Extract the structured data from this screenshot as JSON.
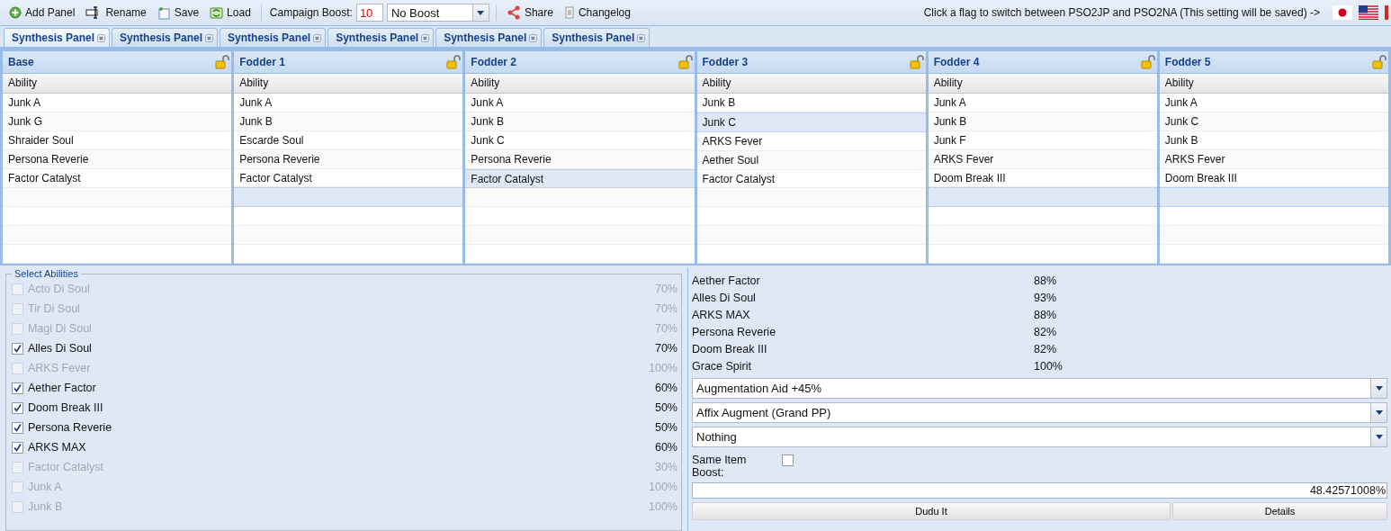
{
  "toolbar": {
    "buttons": [
      {
        "kind": "add",
        "label": "Add Panel"
      },
      {
        "kind": "rename",
        "label": "Rename"
      },
      {
        "kind": "save",
        "label": "Save"
      },
      {
        "kind": "load",
        "label": "Load"
      }
    ],
    "campaign_label": "Campaign Boost:",
    "campaign_value": "10",
    "boost_select": "No Boost",
    "links": [
      {
        "kind": "share",
        "label": "Share"
      },
      {
        "kind": "changelog",
        "label": "Changelog"
      }
    ],
    "flag_hint": "Click a flag to switch between PSO2JP and PSO2NA (This setting will be saved) ->",
    "flags": [
      {
        "kind": "jp"
      },
      {
        "kind": "us"
      },
      {
        "kind": "ca"
      }
    ]
  },
  "tabs": [
    {
      "label": "Synthesis Panel",
      "selected": true
    },
    {
      "label": "Synthesis Panel",
      "selected": false
    },
    {
      "label": "Synthesis Panel",
      "selected": false
    },
    {
      "label": "Synthesis Panel",
      "selected": false
    },
    {
      "label": "Synthesis Panel",
      "selected": false
    },
    {
      "label": "Synthesis Panel",
      "selected": false
    }
  ],
  "panels": [
    {
      "title": "Base",
      "column": "Ability",
      "rows": [
        {
          "ability": "Junk A",
          "selected": false
        },
        {
          "ability": "Junk G",
          "selected": false
        },
        {
          "ability": "Shraider Soul",
          "selected": false
        },
        {
          "ability": "Persona Reverie",
          "selected": false
        },
        {
          "ability": "Factor Catalyst",
          "selected": false
        }
      ],
      "empty_rows": [
        {
          "selected": false
        },
        {
          "selected": false
        },
        {
          "selected": false
        },
        {
          "selected": false
        }
      ]
    },
    {
      "title": "Fodder 1",
      "column": "Ability",
      "rows": [
        {
          "ability": "Junk A",
          "selected": false
        },
        {
          "ability": "Junk B",
          "selected": false
        },
        {
          "ability": "Escarde Soul",
          "selected": false
        },
        {
          "ability": "Persona Reverie",
          "selected": false
        },
        {
          "ability": "Factor Catalyst",
          "selected": false
        }
      ],
      "empty_rows": [
        {
          "selected": true
        },
        {
          "selected": false
        },
        {
          "selected": false
        },
        {
          "selected": false
        }
      ]
    },
    {
      "title": "Fodder 2",
      "column": "Ability",
      "rows": [
        {
          "ability": "Junk A",
          "selected": false
        },
        {
          "ability": "Junk B",
          "selected": false
        },
        {
          "ability": "Junk C",
          "selected": false
        },
        {
          "ability": "Persona Reverie",
          "selected": false
        },
        {
          "ability": "Factor Catalyst",
          "selected": true
        }
      ],
      "empty_rows": [
        {
          "selected": false
        },
        {
          "selected": false
        },
        {
          "selected": false
        },
        {
          "selected": false
        }
      ]
    },
    {
      "title": "Fodder 3",
      "column": "Ability",
      "rows": [
        {
          "ability": "Junk B",
          "selected": false
        },
        {
          "ability": "Junk C",
          "selected": true
        },
        {
          "ability": "ARKS Fever",
          "selected": false
        },
        {
          "ability": "Aether Soul",
          "selected": false
        },
        {
          "ability": "Factor Catalyst",
          "selected": false
        }
      ],
      "empty_rows": [
        {
          "selected": false
        },
        {
          "selected": false
        },
        {
          "selected": false
        },
        {
          "selected": false
        }
      ]
    },
    {
      "title": "Fodder 4",
      "column": "Ability",
      "rows": [
        {
          "ability": "Junk A",
          "selected": false
        },
        {
          "ability": "Junk B",
          "selected": false
        },
        {
          "ability": "Junk F",
          "selected": false
        },
        {
          "ability": "ARKS Fever",
          "selected": false
        },
        {
          "ability": "Doom Break III",
          "selected": false
        }
      ],
      "empty_rows": [
        {
          "selected": true
        },
        {
          "selected": false
        },
        {
          "selected": false
        },
        {
          "selected": false
        }
      ]
    },
    {
      "title": "Fodder 5",
      "column": "Ability",
      "rows": [
        {
          "ability": "Junk A",
          "selected": false
        },
        {
          "ability": "Junk C",
          "selected": false
        },
        {
          "ability": "Junk B",
          "selected": false
        },
        {
          "ability": "ARKS Fever",
          "selected": false
        },
        {
          "ability": "Doom Break III",
          "selected": false
        }
      ],
      "empty_rows": [
        {
          "selected": true
        },
        {
          "selected": false
        },
        {
          "selected": false
        },
        {
          "selected": false
        }
      ]
    }
  ],
  "select_abilities": {
    "legend": "Select Abilities",
    "items": [
      {
        "name": "Acto Di Soul",
        "rate": "70%",
        "checked": false,
        "disabled": true
      },
      {
        "name": "Tir Di Soul",
        "rate": "70%",
        "checked": false,
        "disabled": true
      },
      {
        "name": "Magi Di Soul",
        "rate": "70%",
        "checked": false,
        "disabled": true
      },
      {
        "name": "Alles Di Soul",
        "rate": "70%",
        "checked": true,
        "disabled": false
      },
      {
        "name": "ARKS Fever",
        "rate": "100%",
        "checked": false,
        "disabled": true
      },
      {
        "name": "Aether Factor",
        "rate": "60%",
        "checked": true,
        "disabled": false
      },
      {
        "name": "Doom Break III",
        "rate": "50%",
        "checked": true,
        "disabled": false
      },
      {
        "name": "Persona Reverie",
        "rate": "50%",
        "checked": true,
        "disabled": false
      },
      {
        "name": "ARKS MAX",
        "rate": "60%",
        "checked": true,
        "disabled": false
      },
      {
        "name": "Factor Catalyst",
        "rate": "30%",
        "checked": false,
        "disabled": true
      },
      {
        "name": "Junk A",
        "rate": "100%",
        "checked": false,
        "disabled": true
      },
      {
        "name": "Junk B",
        "rate": "100%",
        "checked": false,
        "disabled": true
      }
    ]
  },
  "results": {
    "items": [
      {
        "name": "Aether Factor",
        "rate": "88%"
      },
      {
        "name": "Alles Di Soul",
        "rate": "93%"
      },
      {
        "name": "ARKS MAX",
        "rate": "88%"
      },
      {
        "name": "Persona Reverie",
        "rate": "82%"
      },
      {
        "name": "Doom Break III",
        "rate": "82%"
      },
      {
        "name": "Grace Spirit",
        "rate": "100%"
      }
    ],
    "selects": [
      "Augmentation Aid +45%",
      "Affix Augment (Grand PP)",
      "Nothing"
    ],
    "same_item_label": "Same Item Boost:",
    "same_item_checked": false,
    "total": "48.42571008%",
    "buttons": [
      "Dudu It",
      "Details"
    ]
  }
}
